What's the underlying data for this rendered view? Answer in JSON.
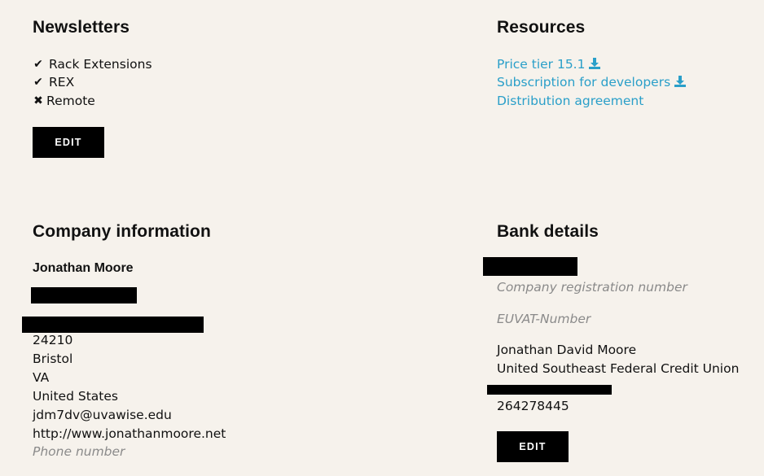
{
  "newsletters": {
    "title": "Newsletters",
    "items": [
      {
        "label": "Rack Extensions",
        "icon": "check-icon",
        "subscribed": true
      },
      {
        "label": "REX",
        "icon": "check-icon",
        "subscribed": true
      },
      {
        "label": "Remote",
        "icon": "x-icon",
        "subscribed": false
      }
    ],
    "edit_label": "EDIT"
  },
  "resources": {
    "title": "Resources",
    "links": [
      {
        "label": "Price tier 15.1",
        "has_download_icon": true
      },
      {
        "label": "Subscription for developers",
        "has_download_icon": true
      },
      {
        "label": "Distribution agreement",
        "has_download_icon": false
      }
    ],
    "link_color": "#2a9fc9"
  },
  "company": {
    "title": "Company information",
    "name": "Jonathan Moore",
    "zip": "24210",
    "city": "Bristol",
    "state": "VA",
    "country": "United States",
    "email": "jdm7dv@uvawise.edu",
    "website": "http://www.jonathanmoore.net",
    "phone_placeholder": "Phone number"
  },
  "bank": {
    "title": "Bank details",
    "reg_placeholder": "Company registration number",
    "vat_placeholder": "EUVAT-Number",
    "account_holder": "Jonathan David Moore",
    "bank_name": "United Southeast Federal Credit Union",
    "routing_number": "264278445",
    "edit_label": "EDIT"
  }
}
